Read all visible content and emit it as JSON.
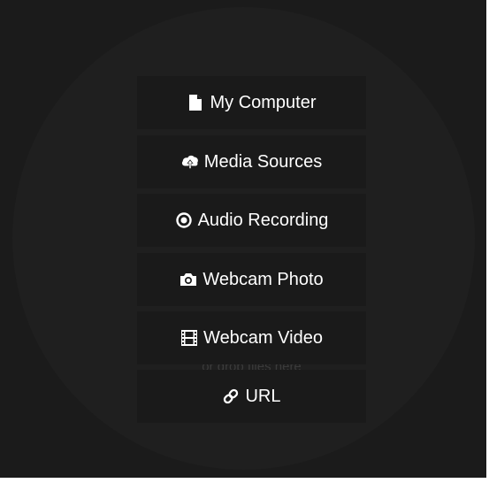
{
  "sources": {
    "my_computer": {
      "label": "My Computer",
      "icon": "file-icon"
    },
    "media_sources": {
      "label": "Media Sources",
      "icon": "cloud-upload-icon"
    },
    "audio_recording": {
      "label": "Audio Recording",
      "icon": "record-icon"
    },
    "webcam_photo": {
      "label": "Webcam Photo",
      "icon": "camera-icon"
    },
    "webcam_video": {
      "label": "Webcam Video",
      "icon": "film-icon"
    },
    "url": {
      "label": "URL",
      "icon": "link-icon"
    }
  },
  "drop_hint": "or drop files here",
  "colors": {
    "background": "#1b1b1b",
    "circle": "#1f1f1f",
    "button": "#1a1a1a",
    "text": "#ffffff",
    "hint": "#3b3b3b"
  }
}
